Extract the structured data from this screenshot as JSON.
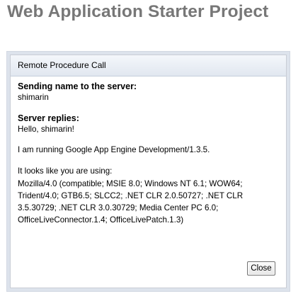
{
  "page": {
    "title": "Web Application Starter Project"
  },
  "dialog": {
    "caption": "Remote Procedure Call",
    "sending_label": "Sending name to the server:",
    "sent_name": "shimarin",
    "replies_label": "Server replies:",
    "reply_greeting": "Hello, shimarin!",
    "reply_running": "I am running Google App Engine Development/1.3.5.",
    "reply_using_label": "It looks like you are using:",
    "reply_user_agent": "Mozilla/4.0 (compatible; MSIE 8.0; Windows NT 6.1; WOW64; Trident/4.0; GTB6.5; SLCC2; .NET CLR 2.0.50727; .NET CLR 3.5.30729; .NET CLR 3.0.30729; Media Center PC 6.0; OfficeLiveConnector.1.4; OfficeLivePatch.1.3)",
    "close_label": "Close"
  },
  "colors": {
    "title": "#777777",
    "caption_bg": "#e1e7f0",
    "dialog_border": "#c9cdd5"
  }
}
